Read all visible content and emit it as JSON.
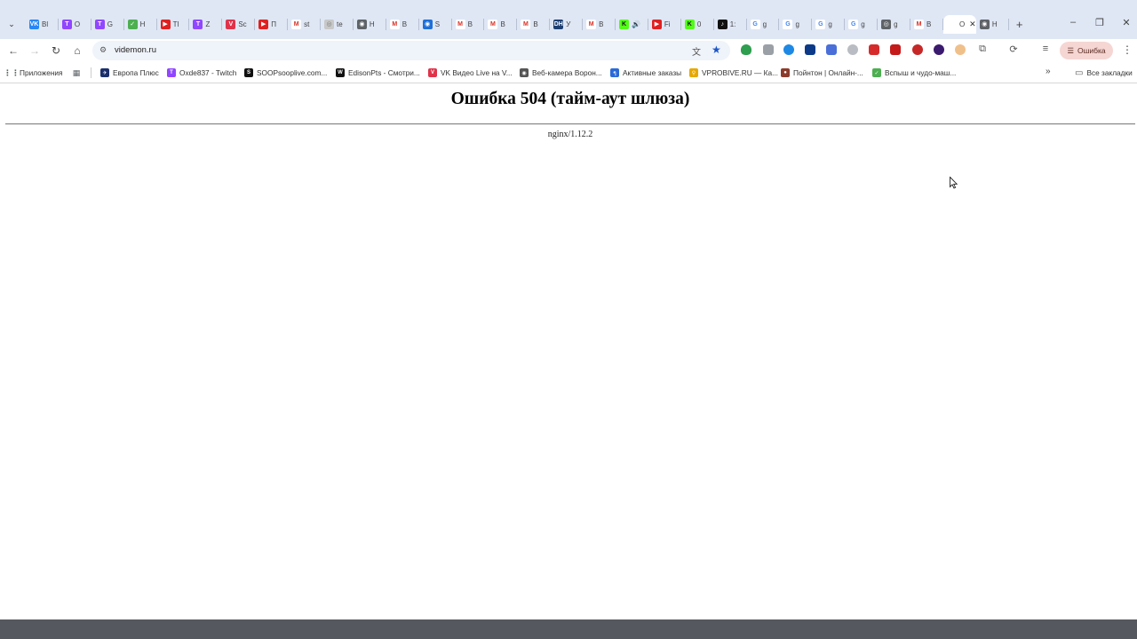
{
  "tabs": [
    {
      "title": "Bl",
      "icon": "vk-icon",
      "color": "#2787f5",
      "glyph": "VK"
    },
    {
      "title": "O",
      "icon": "twitch-icon",
      "color": "#9146ff",
      "glyph": "T"
    },
    {
      "title": "G",
      "icon": "twitch-icon",
      "color": "#9146ff",
      "glyph": "T"
    },
    {
      "title": "H",
      "icon": "check-icon",
      "color": "#4caf50",
      "glyph": "✓"
    },
    {
      "title": "Tl",
      "icon": "youtube-icon",
      "color": "#e02020",
      "glyph": "▶"
    },
    {
      "title": "Z",
      "icon": "twitch-icon",
      "color": "#9146ff",
      "glyph": "T"
    },
    {
      "title": "Sc",
      "icon": "vk-video-icon",
      "color": "#e0334a",
      "glyph": "V"
    },
    {
      "title": "Π",
      "icon": "youtube-icon",
      "color": "#e02020",
      "glyph": "▶"
    },
    {
      "title": "st",
      "icon": "gmail-icon",
      "color": "#ffffff",
      "glyph": "M"
    },
    {
      "title": "te",
      "icon": "globe-icon",
      "color": "#c8c8c8",
      "glyph": "◎"
    },
    {
      "title": "H",
      "icon": "chrome-icon",
      "color": "#5f6368",
      "glyph": "◉"
    },
    {
      "title": "B",
      "icon": "gmail-icon",
      "color": "#ffffff",
      "glyph": "M"
    },
    {
      "title": "S",
      "icon": "sync-icon",
      "color": "#1e6fd9",
      "glyph": "◉"
    },
    {
      "title": "B",
      "icon": "gmail-icon",
      "color": "#ffffff",
      "glyph": "M"
    },
    {
      "title": "B",
      "icon": "gmail-icon",
      "color": "#ffffff",
      "glyph": "M"
    },
    {
      "title": "B",
      "icon": "gmail-icon",
      "color": "#ffffff",
      "glyph": "M"
    },
    {
      "title": "У",
      "icon": "dh-icon",
      "color": "#1d3f72",
      "glyph": "DH"
    },
    {
      "title": "B",
      "icon": "gmail-icon",
      "color": "#ffffff",
      "glyph": "M"
    },
    {
      "title": "🔊",
      "icon": "kick-icon",
      "color": "#53fc18",
      "glyph": "K"
    },
    {
      "title": "Fi",
      "icon": "youtube-icon",
      "color": "#e02020",
      "glyph": "▶"
    },
    {
      "title": "0",
      "icon": "kick-icon",
      "color": "#53fc18",
      "glyph": "K"
    },
    {
      "title": "1:",
      "icon": "tiktok-icon",
      "color": "#111111",
      "glyph": "♪"
    },
    {
      "title": "g",
      "icon": "google-icon",
      "color": "#ffffff",
      "glyph": "G"
    },
    {
      "title": "g",
      "icon": "google-icon",
      "color": "#ffffff",
      "glyph": "G"
    },
    {
      "title": "g",
      "icon": "google-icon",
      "color": "#ffffff",
      "glyph": "G"
    },
    {
      "title": "g",
      "icon": "google-icon",
      "color": "#ffffff",
      "glyph": "G"
    },
    {
      "title": "g",
      "icon": "lens-icon",
      "color": "#5f6368",
      "glyph": "◎"
    },
    {
      "title": "B",
      "icon": "gmail-icon",
      "color": "#ffffff",
      "glyph": "M"
    },
    {
      "title": "О",
      "icon": "globe-icon",
      "color": "#ffffff",
      "glyph": "",
      "active": true
    },
    {
      "title": "H",
      "icon": "chrome-icon",
      "color": "#5f6368",
      "glyph": "◉"
    }
  ],
  "toolbar": {
    "url": "videmon.ru",
    "profile_label": "Ошибка"
  },
  "bookmarks": [
    {
      "label": "Приложения",
      "icon": "apps-grid-icon",
      "color": "#5f6368",
      "glyph": "⋮⋮"
    },
    {
      "label": "",
      "icon": "grid-icon",
      "color": "#5f6368",
      "glyph": "▦"
    },
    {
      "label": "Европа Плюс",
      "icon": "radio-icon",
      "color": "#1a2f6b",
      "glyph": "✈"
    },
    {
      "label": "Oxde837 - Twitch",
      "icon": "twitch-icon",
      "color": "#9146ff",
      "glyph": "T"
    },
    {
      "label": "SOOPsooplive.com...",
      "icon": "soop-icon",
      "color": "#111111",
      "glyph": "S"
    },
    {
      "label": "EdisonPts - Смотри...",
      "icon": "w-icon",
      "color": "#111111",
      "glyph": "W"
    },
    {
      "label": "VK Видео Live на V...",
      "icon": "vk-video-icon",
      "color": "#e0334a",
      "glyph": "V"
    },
    {
      "label": "Веб-камера Ворон...",
      "icon": "webcam-icon",
      "color": "#555555",
      "glyph": "◉"
    },
    {
      "label": "Активные заказы",
      "icon": "orders-icon",
      "color": "#2a6ad8",
      "glyph": "ๆ"
    },
    {
      "label": "VPROBIVE.RU — Ка...",
      "icon": "key-icon",
      "color": "#e6a800",
      "glyph": "⚲"
    },
    {
      "label": "Пойнтон | Онлайн-...",
      "icon": "pointon-icon",
      "color": "#8c3b2b",
      "glyph": "●"
    },
    {
      "label": "Вспыш и чудо-маш...",
      "icon": "check-icon",
      "color": "#4caf50",
      "glyph": "✓"
    }
  ],
  "bookmarks_all_label": "Все закладки",
  "page": {
    "title": "Ошибка 504 (тайм-аут шлюза)",
    "server": "nginx/1.12.2"
  }
}
